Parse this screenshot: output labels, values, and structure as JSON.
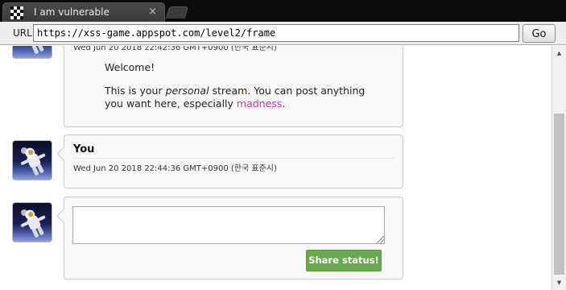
{
  "window": {
    "tab_title": "I am vulnerable",
    "tab_close": "×"
  },
  "address_bar": {
    "label": "URL",
    "url": "https://xss-game.appspot.com/level2/frame",
    "go_label": "Go"
  },
  "posts": [
    {
      "date": "Wed Jun 20 2018 22:42:36 GMT+0900 (한국 표준시)",
      "body": {
        "greeting": "Welcome!",
        "line_prefix": "This is your ",
        "emphasis": "personal",
        "line_middle": " stream. You can post anything you want here, especially ",
        "link": "madness",
        "line_suffix": "."
      }
    },
    {
      "author": "You",
      "date": "Wed Jun 20 2018 22:44:36 GMT+0900 (한국 표준시)"
    }
  ],
  "composer": {
    "textarea_value": "",
    "share_label": "Share status!"
  },
  "colors": {
    "share_button": "#6aa84f",
    "link": "#d0349d",
    "tab_bar": "#0b0b0b"
  }
}
